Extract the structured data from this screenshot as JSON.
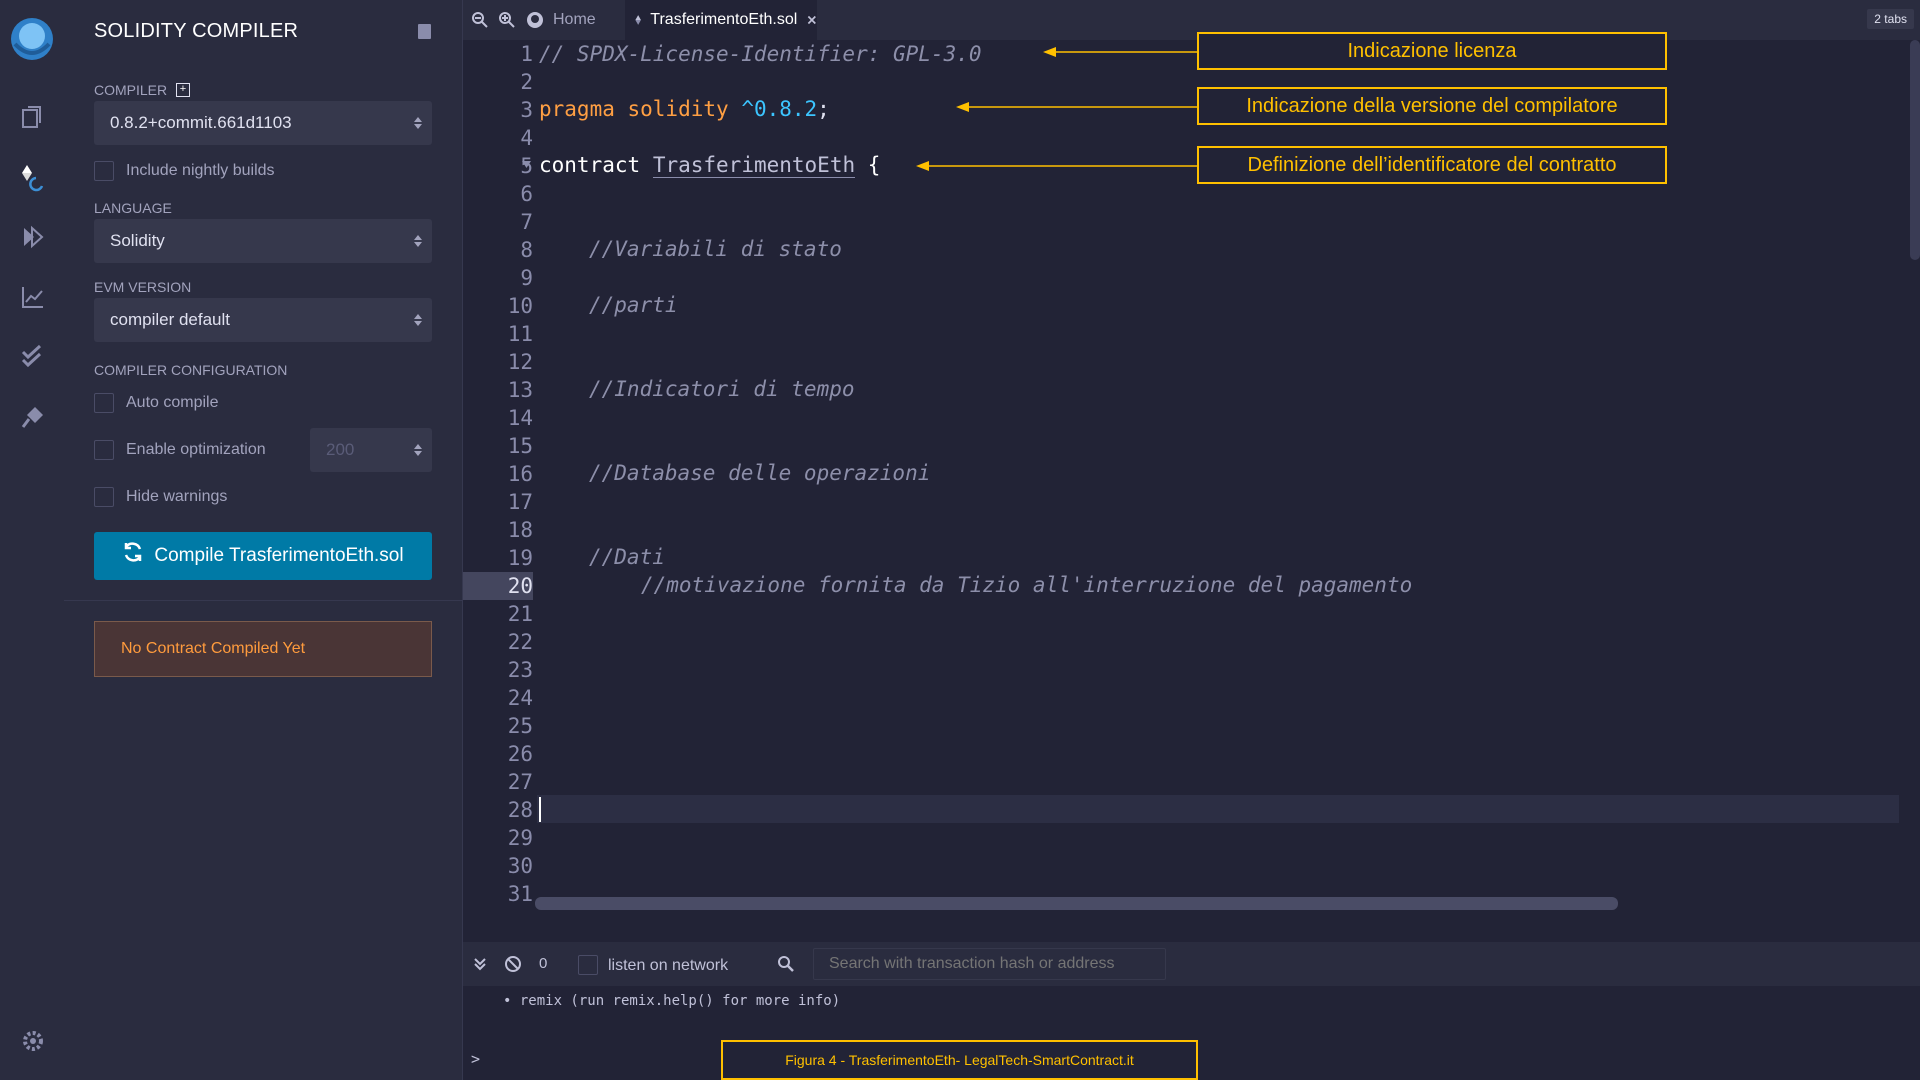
{
  "sidebar": {
    "title": "SOLIDITY COMPILER",
    "compiler_label": "COMPILER",
    "compiler_value": "0.8.2+commit.661d1103",
    "nightly_label": "Include nightly builds",
    "language_label": "LANGUAGE",
    "language_value": "Solidity",
    "evm_label": "EVM VERSION",
    "evm_value": "compiler default",
    "config_label": "COMPILER CONFIGURATION",
    "auto_compile_label": "Auto compile",
    "optimization_label": "Enable optimization",
    "runs_value": "200",
    "hide_warnings_label": "Hide warnings",
    "compile_button": "Compile TrasferimentoEth.sol",
    "no_contract": "No Contract Compiled Yet"
  },
  "tabs": {
    "home": "Home",
    "file": "TrasferimentoEth.sol",
    "count": "2 tabs"
  },
  "editor": {
    "line_numbers": [
      "1",
      "2",
      "3",
      "4",
      "5",
      "6",
      "7",
      "8",
      "9",
      "10",
      "11",
      "12",
      "13",
      "14",
      "15",
      "16",
      "17",
      "18",
      "19",
      "20",
      "21",
      "22",
      "23",
      "24",
      "25",
      "26",
      "27",
      "28",
      "29",
      "30",
      "31"
    ],
    "license_line": "// SPDX-License-Identifier: GPL-3.0",
    "pragma_kw": "pragma solidity",
    "pragma_ver": "^0.8.2",
    "pragma_end": ";",
    "contract_kw": "contract",
    "contract_name": "TrasferimentoEth",
    "contract_brace": "{",
    "c_stato": "//Variabili di stato",
    "c_parti": "//parti",
    "c_tempo": "//Indicatori di tempo",
    "c_db": "//Database delle operazioni",
    "c_dati": "//Dati",
    "c_motiv": "//motivazione fornita da Tizio all'interruzione del pagamento"
  },
  "annotations": {
    "license": "Indicazione licenza",
    "version": "Indicazione della versione del compilatore",
    "identifier": "Definizione dell’identificatore del contratto"
  },
  "terminal": {
    "count": "0",
    "listen_label": "listen on network",
    "search_placeholder": "Search with transaction hash or address",
    "log_line": "• remix (run remix.help() for more info)",
    "prompt": ">"
  },
  "caption": "Figura 4 - TrasferimentoEth- LegalTech-SmartContract.it"
}
